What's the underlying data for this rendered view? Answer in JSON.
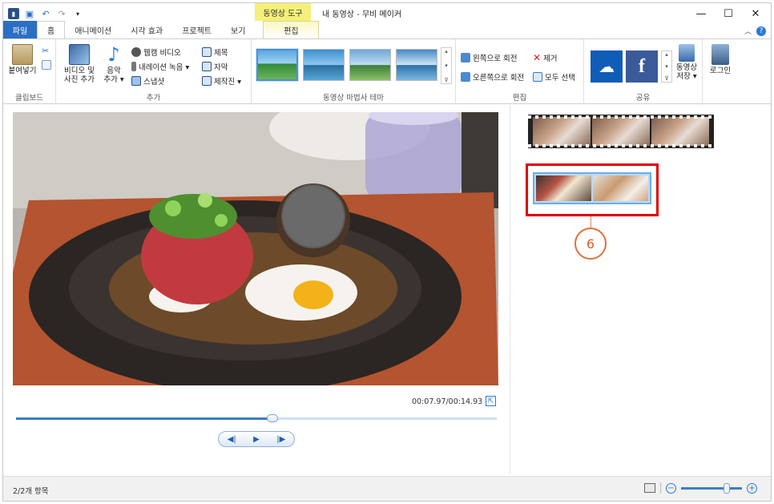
{
  "window": {
    "title": "내 동영상 - 무비 메이커",
    "context_tab": "동영상 도구",
    "controls": {
      "minimize": "—",
      "maximize": "☐",
      "close": "✕"
    }
  },
  "tabs": [
    {
      "label": "파일"
    },
    {
      "label": "홈"
    },
    {
      "label": "애니메이션"
    },
    {
      "label": "시각 효과"
    },
    {
      "label": "프로젝트"
    },
    {
      "label": "보기"
    },
    {
      "label": "편집"
    }
  ],
  "ribbon": {
    "clipboard": {
      "paste": "붙여넣기",
      "label": "클립보드"
    },
    "add": {
      "add_video_photo": "비디오 및\n사진 추가",
      "add_music": "음악\n추가 ▾",
      "webcam": "웹캠 비디오",
      "narration": "내레이션 녹음 ▾",
      "snapshot": "스냅샷",
      "title": "제목",
      "caption": "자막",
      "credits": "제작진 ▾",
      "label": "추가"
    },
    "themes": {
      "label": "동영상 마법사 테마"
    },
    "editing": {
      "rotate_left": "왼쪽으로 회전",
      "rotate_right": "오른쪽으로 회전",
      "remove": "제거",
      "select_all": "모두 선택",
      "label": "편집"
    },
    "share": {
      "save_movie": "동영상\n저장 ▾",
      "label": "공유"
    },
    "signin": {
      "label": "로그인"
    }
  },
  "player": {
    "timecode": "00:07.97/00:14.93",
    "progress": 0.534
  },
  "storyboard": {
    "callout_number": "6"
  },
  "status": {
    "items_text": "2/2개 항목",
    "zoom_level": 0.75
  },
  "colors": {
    "accent": "#2b6fc4",
    "context_tab": "#f4f07a",
    "highlight": "#e00000",
    "callout": "#e0703c"
  }
}
